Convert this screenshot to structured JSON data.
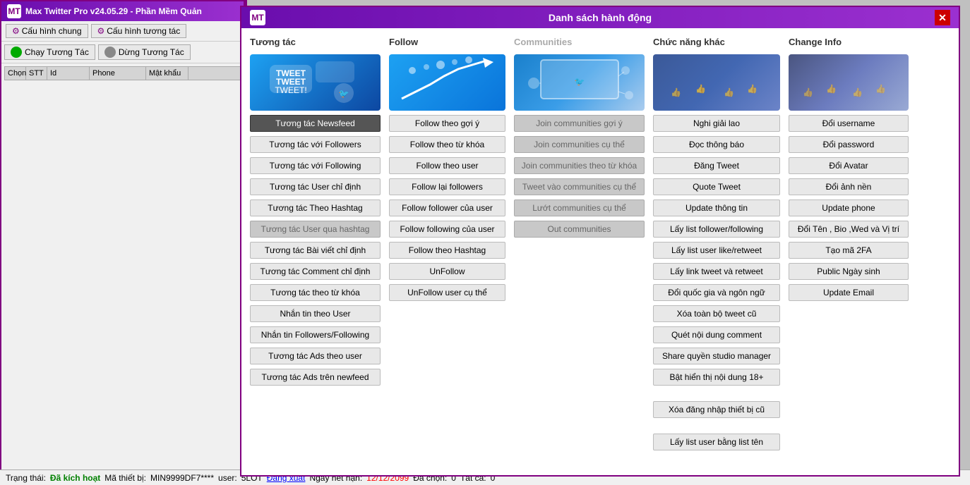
{
  "app": {
    "title": "Max Twitter Pro v24.05.29 - Phần Mềm Quản",
    "logo": "MT"
  },
  "toolbar": {
    "cau_hinh_chung": "Cấu hình chung",
    "cau_hinh_tuong_tac": "Cấu hình tương tác",
    "chay_tuong_tac": "Chạy Tương Tác",
    "dung_tuong_tac": "Dừng Tương Tác"
  },
  "table": {
    "headers": [
      "Chọn",
      "STT",
      "Id",
      "Phone",
      "Mật khẩu"
    ]
  },
  "modal": {
    "title": "Danh sách hành động",
    "logo": "MT",
    "close": "✕"
  },
  "sections": {
    "tuong_tac": {
      "header": "Tương tác",
      "buttons": [
        "Tương tác Newsfeed",
        "Tương tác với Followers",
        "Tương tác với Following",
        "Tương tác User chỉ định",
        "Tương tác Theo Hashtag",
        "Tương tác User qua hashtag",
        "Tương tác Bài viết chỉ định",
        "Tương tác Comment chỉ định",
        "Tương tác theo từ khóa",
        "Nhắn tin theo User",
        "Nhắn tin Followers/Following",
        "Tương tác Ads theo user",
        "Tương tác Ads trên newfeed"
      ],
      "dark_btn": "Tương tác Newsfeed",
      "grey_btn": "Tương tác User qua hashtag"
    },
    "follow": {
      "header": "Follow",
      "buttons": [
        "Follow theo gợi ý",
        "Follow theo từ khóa",
        "Follow theo user",
        "Follow lại followers",
        "Follow follower của user",
        "Follow following của user",
        "Follow theo Hashtag",
        "UnFollow",
        "UnFollow user cụ thể"
      ]
    },
    "communities": {
      "header": "Communities",
      "buttons": [
        "Join communities gợi ý",
        "Join communities cụ thể",
        "Join communities theo từ khóa",
        "Tweet vào communities cụ thể",
        "Lướt communities cụ thể",
        "Out communities"
      ],
      "grey_buttons": [
        "Join communities gợi ý",
        "Join communities cụ thể",
        "Join communities theo từ khóa",
        "Tweet vào communities cụ thể",
        "Lướt communities cụ thể",
        "Out communities"
      ]
    },
    "chuc_nang": {
      "header": "Chức năng khác",
      "buttons": [
        "Nghi giải lao",
        "Đọc thông báo",
        "Đăng Tweet",
        "Quote Tweet",
        "Update thông tin",
        "Lấy list follower/following",
        "Lấy list user like/retweet",
        "Lấy link tweet và retweet",
        "Đổi quốc gia và ngôn ngữ",
        "Xóa toàn bộ tweet cũ",
        "Quét nội dung comment",
        "Share quyền studio manager",
        "Bật hiển thị nội dung 18+",
        "Xóa đăng nhập thiết bị cũ",
        "Lấy list user bằng list tên"
      ]
    },
    "change_info": {
      "header": "Change Info",
      "buttons": [
        "Đổi username",
        "Đổi password",
        "Đổi Avatar",
        "Đổi ảnh nền",
        "Update phone",
        "Đổi Tên , Bio ,Wed và Vị trí",
        "Tạo mã 2FA",
        "Public Ngày sinh",
        "Update Email"
      ]
    }
  },
  "status_bar": {
    "label_trang_thai": "Trạng thái:",
    "trang_thai_value": "Đã kích hoạt",
    "label_ma_thiet_bi": "Mã thiết bị:",
    "ma_thiet_bi_value": "MIN9999DF7****",
    "label_user": "user:",
    "user_value": "5LOT",
    "dang_xuat": "Đăng xuất",
    "label_ngay": "Ngày hết hạn:",
    "ngay_value": "12/12/2099",
    "label_da_chon": "Đã chọn:",
    "da_chon_value": "0",
    "label_tat_ca": "Tất cả:",
    "tat_ca_value": "0"
  }
}
